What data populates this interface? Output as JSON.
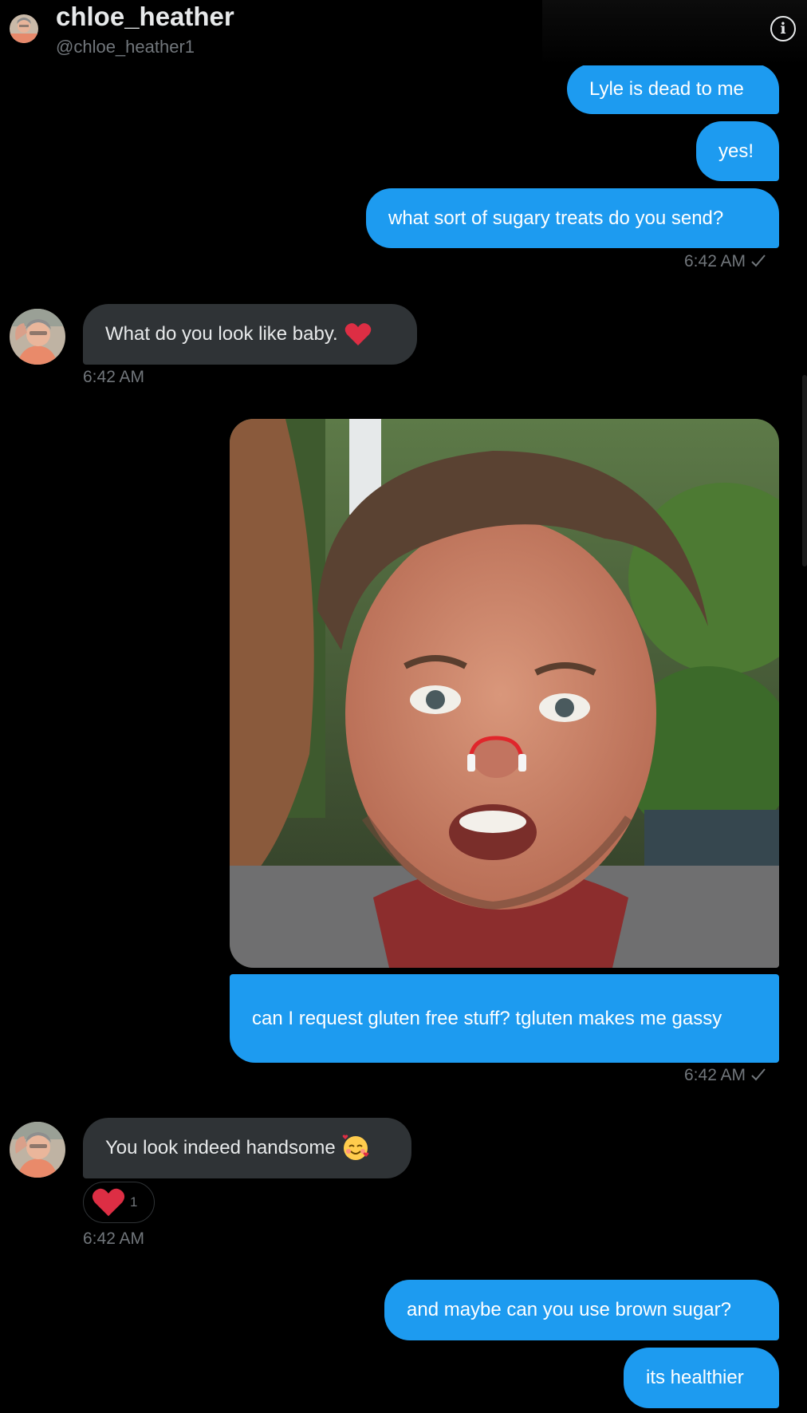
{
  "header": {
    "display_name": "chloe_heather",
    "handle": "@chloe_heather1",
    "info_icon": "info-icon"
  },
  "messages": [
    {
      "side": "sent",
      "text": "Lyle is dead to me"
    },
    {
      "side": "sent",
      "text": "yes!"
    },
    {
      "side": "sent",
      "text": "what sort of sugary treats do you send?",
      "time": "6:42 AM"
    },
    {
      "side": "received",
      "text": "What do you look like baby.",
      "emoji": "red-heart-emoji",
      "time": "6:42 AM"
    },
    {
      "side": "sent",
      "type": "photo",
      "photo_desc": "selfie"
    },
    {
      "side": "sent",
      "text": "can I request gluten free stuff? tgluten makes me gassy",
      "time": "6:42 AM"
    },
    {
      "side": "received",
      "text": "You look indeed handsome",
      "emoji": "smiling-face-with-hearts-emoji",
      "reaction": {
        "icon": "red-heart-emoji",
        "count": "1"
      },
      "time": "6:42 AM"
    },
    {
      "side": "sent",
      "text": "and maybe can you use brown sugar?"
    },
    {
      "side": "sent",
      "text": "its healthier"
    }
  ],
  "colors": {
    "background": "#000000",
    "sent_bubble": "#1d9bf0",
    "received_bubble": "#2f3336",
    "timestamp": "#71767b",
    "heart": "#f91880"
  }
}
